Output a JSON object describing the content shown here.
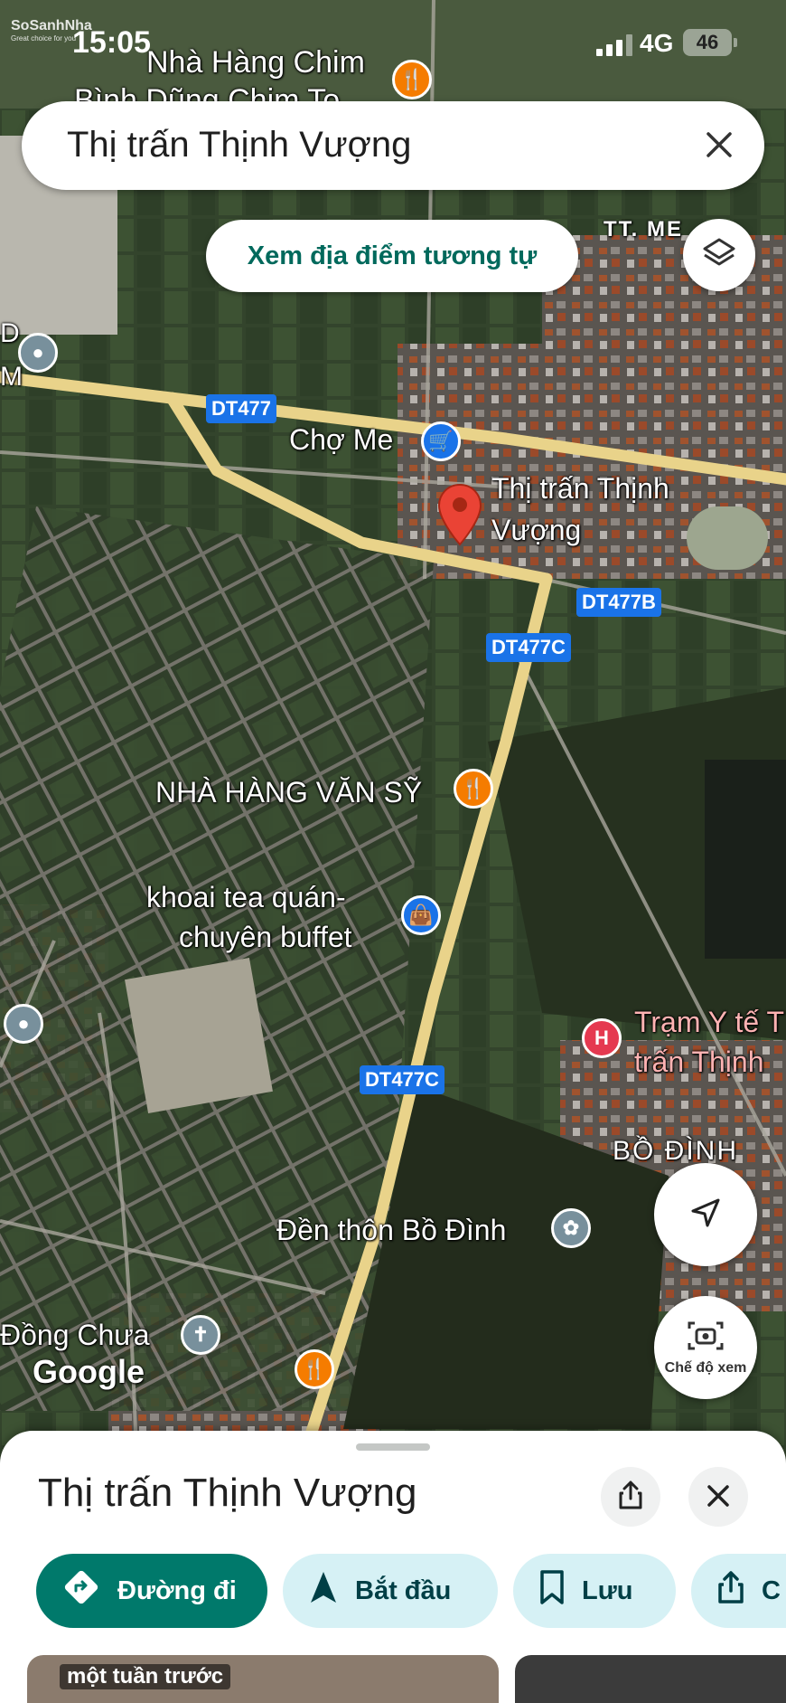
{
  "status_bar": {
    "time": "15:05",
    "brand": "SoSanhNha",
    "brand_tagline": "Great choice for you",
    "network": "4G",
    "battery": "46"
  },
  "search": {
    "query": "Thị trấn Thịnh Vượng",
    "close_icon": "close-icon"
  },
  "similar_places_button": "Xem địa điểm tương tự",
  "map": {
    "labels": {
      "restaurant_top": "Nhà Hàng Chim",
      "restaurant_top_line2": "Bình Dũng Chim To",
      "tt_me": "TT. ME",
      "cho_me": "Chợ Me",
      "place_name_line1": "Thị trấn Thịnh",
      "place_name_line2": "Vượng",
      "nha_hang_van_sy": "NHÀ HÀNG VĂN SỸ",
      "khoai_tea_line1": "khoai tea quán-",
      "khoai_tea_line2": "chuyên buffet",
      "tram_y_te_line1": "Trạm Y tế T",
      "tram_y_te_line2": "trấn Thịnh",
      "bo_dinh": "BỒ ĐÌNH",
      "den_thon": "Đền thôn Bồ Đình",
      "dong_chua": "Đồng Chưa",
      "edge_left_1": "D",
      "edge_left_2": "M"
    },
    "roads": {
      "dt477": "DT477",
      "dt477b": "DT477B",
      "dt477c_1": "DT477C",
      "dt477c_2": "DT477C"
    },
    "google_logo": "Google",
    "colors": {
      "road_yellow": "#f1d98c",
      "shield_blue": "#1a73e8",
      "restaurant_orange": "#f57c00",
      "shop_blue": "#1a73e8",
      "hospital_red": "#e53950",
      "pin_red": "#ea4335",
      "generic_gray": "#78909c"
    }
  },
  "controls": {
    "layers_icon": "layers-icon",
    "locate_icon": "navigation-arrow-icon",
    "view_mode_label": "Chế độ xem"
  },
  "sheet": {
    "title": "Thị trấn Thịnh Vượng",
    "actions": {
      "directions": "Đường đi",
      "start": "Bắt đầu",
      "save": "Lưu",
      "share": "C"
    },
    "photo_caption": "một tuần trước"
  }
}
